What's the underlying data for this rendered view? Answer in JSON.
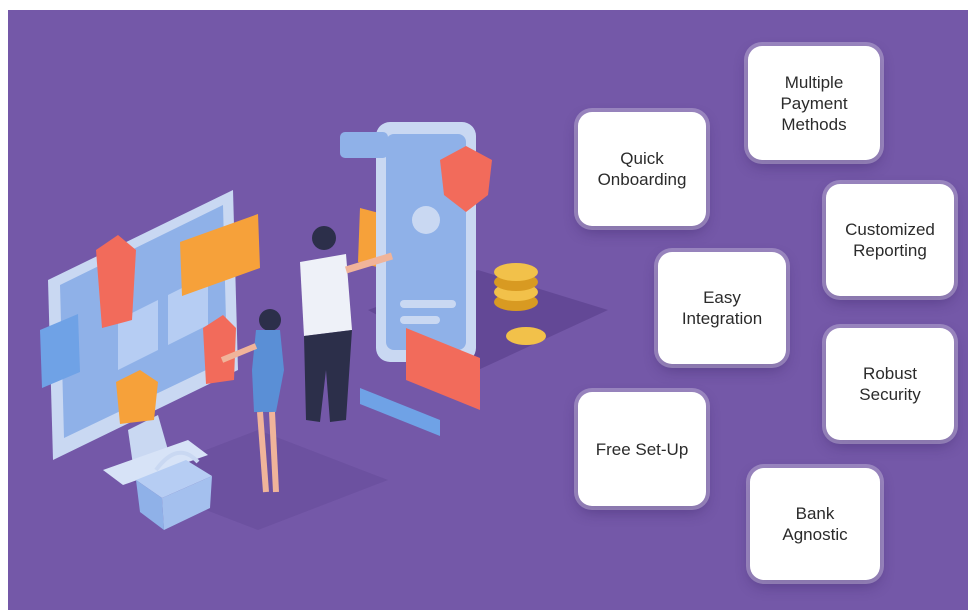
{
  "features": [
    {
      "label": "Quick\nOnboarding"
    },
    {
      "label": "Multiple\nPayment\nMethods"
    },
    {
      "label": "Customized\nReporting"
    },
    {
      "label": "Easy\nIntegration"
    },
    {
      "label": "Robust\nSecurity"
    },
    {
      "label": "Free Set-Up"
    },
    {
      "label": "Bank\nAgnostic"
    }
  ],
  "colors": {
    "background": "#7458a8",
    "card": "#ffffff",
    "accent_orange": "#f6a13a",
    "accent_coral": "#f26b5b"
  }
}
